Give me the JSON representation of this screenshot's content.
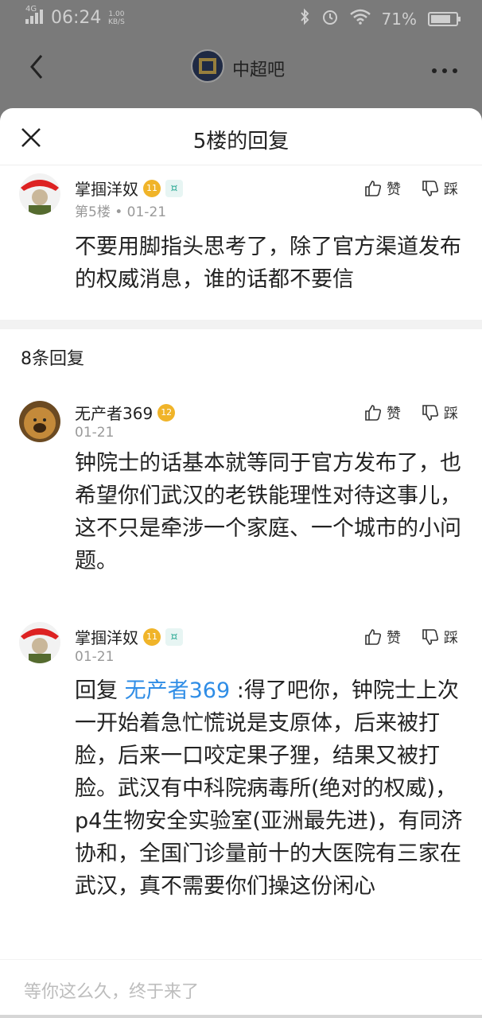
{
  "status": {
    "network": "4G",
    "time": "06:24",
    "speed": "1.00",
    "speed_unit": "KB/S",
    "battery": "71%"
  },
  "topbar": {
    "forum_name": "中超吧"
  },
  "sheet": {
    "title": "5楼的回复"
  },
  "main_post": {
    "author": "掌掴洋奴",
    "level": "11",
    "floor": "第5楼",
    "date": "01-21",
    "content": "不要用脚指头思考了，除了官方渠道发布的权威消息，谁的话都不要信",
    "like_label": "赞",
    "dislike_label": "踩"
  },
  "reply_count": "8条回复",
  "replies": [
    {
      "author": "无产者369",
      "level": "12",
      "date": "01-21",
      "content": "钟院士的话基本就等同于官方发布了，也希望你们武汉的老铁能理性对待这事儿，这不只是牵涉一个家庭、一个城市的小问题。",
      "like_label": "赞",
      "dislike_label": "踩"
    },
    {
      "author": "掌掴洋奴",
      "level": "11",
      "date": "01-21",
      "reply_prefix": "回复",
      "mention": "无产者369",
      "content": ":得了吧你，钟院士上次一开始着急忙慌说是支原体，后来被打脸，后来一口咬定果子狸，结果又被打脸。武汉有中科院病毒所(绝对的权威)，p4生物安全实验室(亚洲最先进)，有同济协和，全国门诊量前十的大医院有三家在武汉，真不需要你们操这份闲心",
      "like_label": "赞",
      "dislike_label": "踩"
    }
  ],
  "input": {
    "placeholder": "等你这么久，终于来了"
  }
}
